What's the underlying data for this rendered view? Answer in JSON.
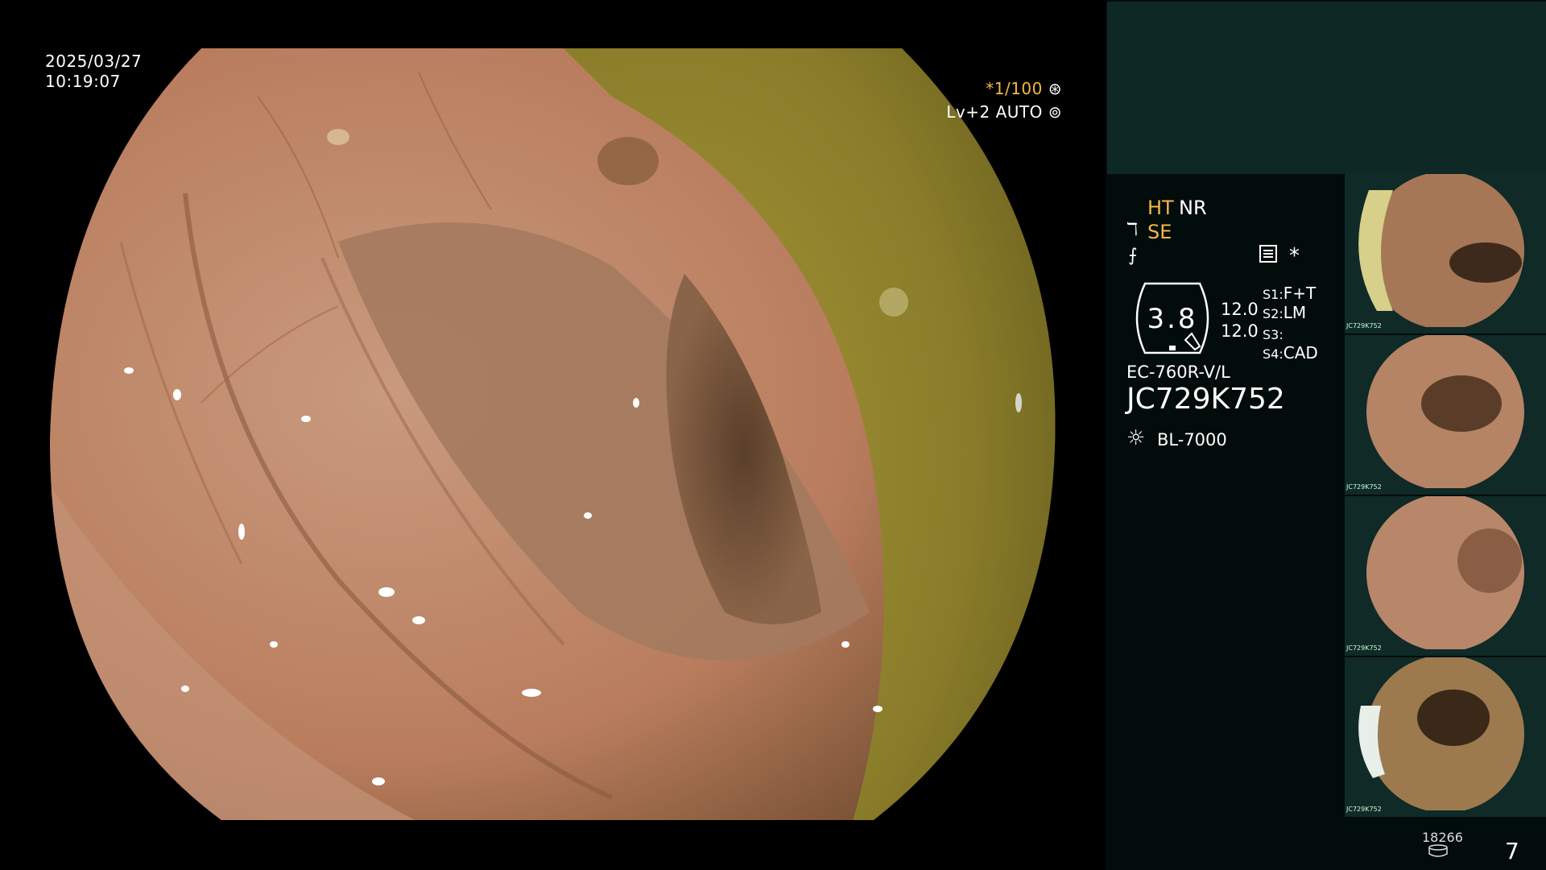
{
  "osd": {
    "date": "2025/03/27",
    "time": "10:19:07",
    "shutter": "*1/100",
    "shutter_icon": "⊛",
    "level": "Lv+2 AUTO",
    "level_icon": "⊚"
  },
  "panel": {
    "ht": "HT",
    "nr": "NR",
    "se_icon": "ℸ",
    "se": "SE",
    "flash_icon": "⨍",
    "menu_icon": "menu-icon",
    "asterisk": "*",
    "badge_value": "3.8",
    "num1": "12.0",
    "num2": "12.0",
    "s1_label": "S1:",
    "s1_value": "F+T",
    "s2_label": "S2:",
    "s2_value": "LM",
    "s3_label": "S3:",
    "s3_value": "",
    "s4_label": "S4:",
    "s4_value": "CAD",
    "model": "EC-760R-V/L",
    "serial": "JC729K752",
    "light_icon": "☼",
    "light_source": "BL-7000",
    "thumbs": [
      {
        "caption": "JC729K752"
      },
      {
        "caption": "JC729K752"
      },
      {
        "caption": "JC729K752"
      },
      {
        "caption": "JC729K752"
      }
    ],
    "count": "18266",
    "page": "7"
  },
  "colors": {
    "accent": "#f3b84a",
    "panel_bg": "#020c0b",
    "teal": "#0e2826"
  }
}
